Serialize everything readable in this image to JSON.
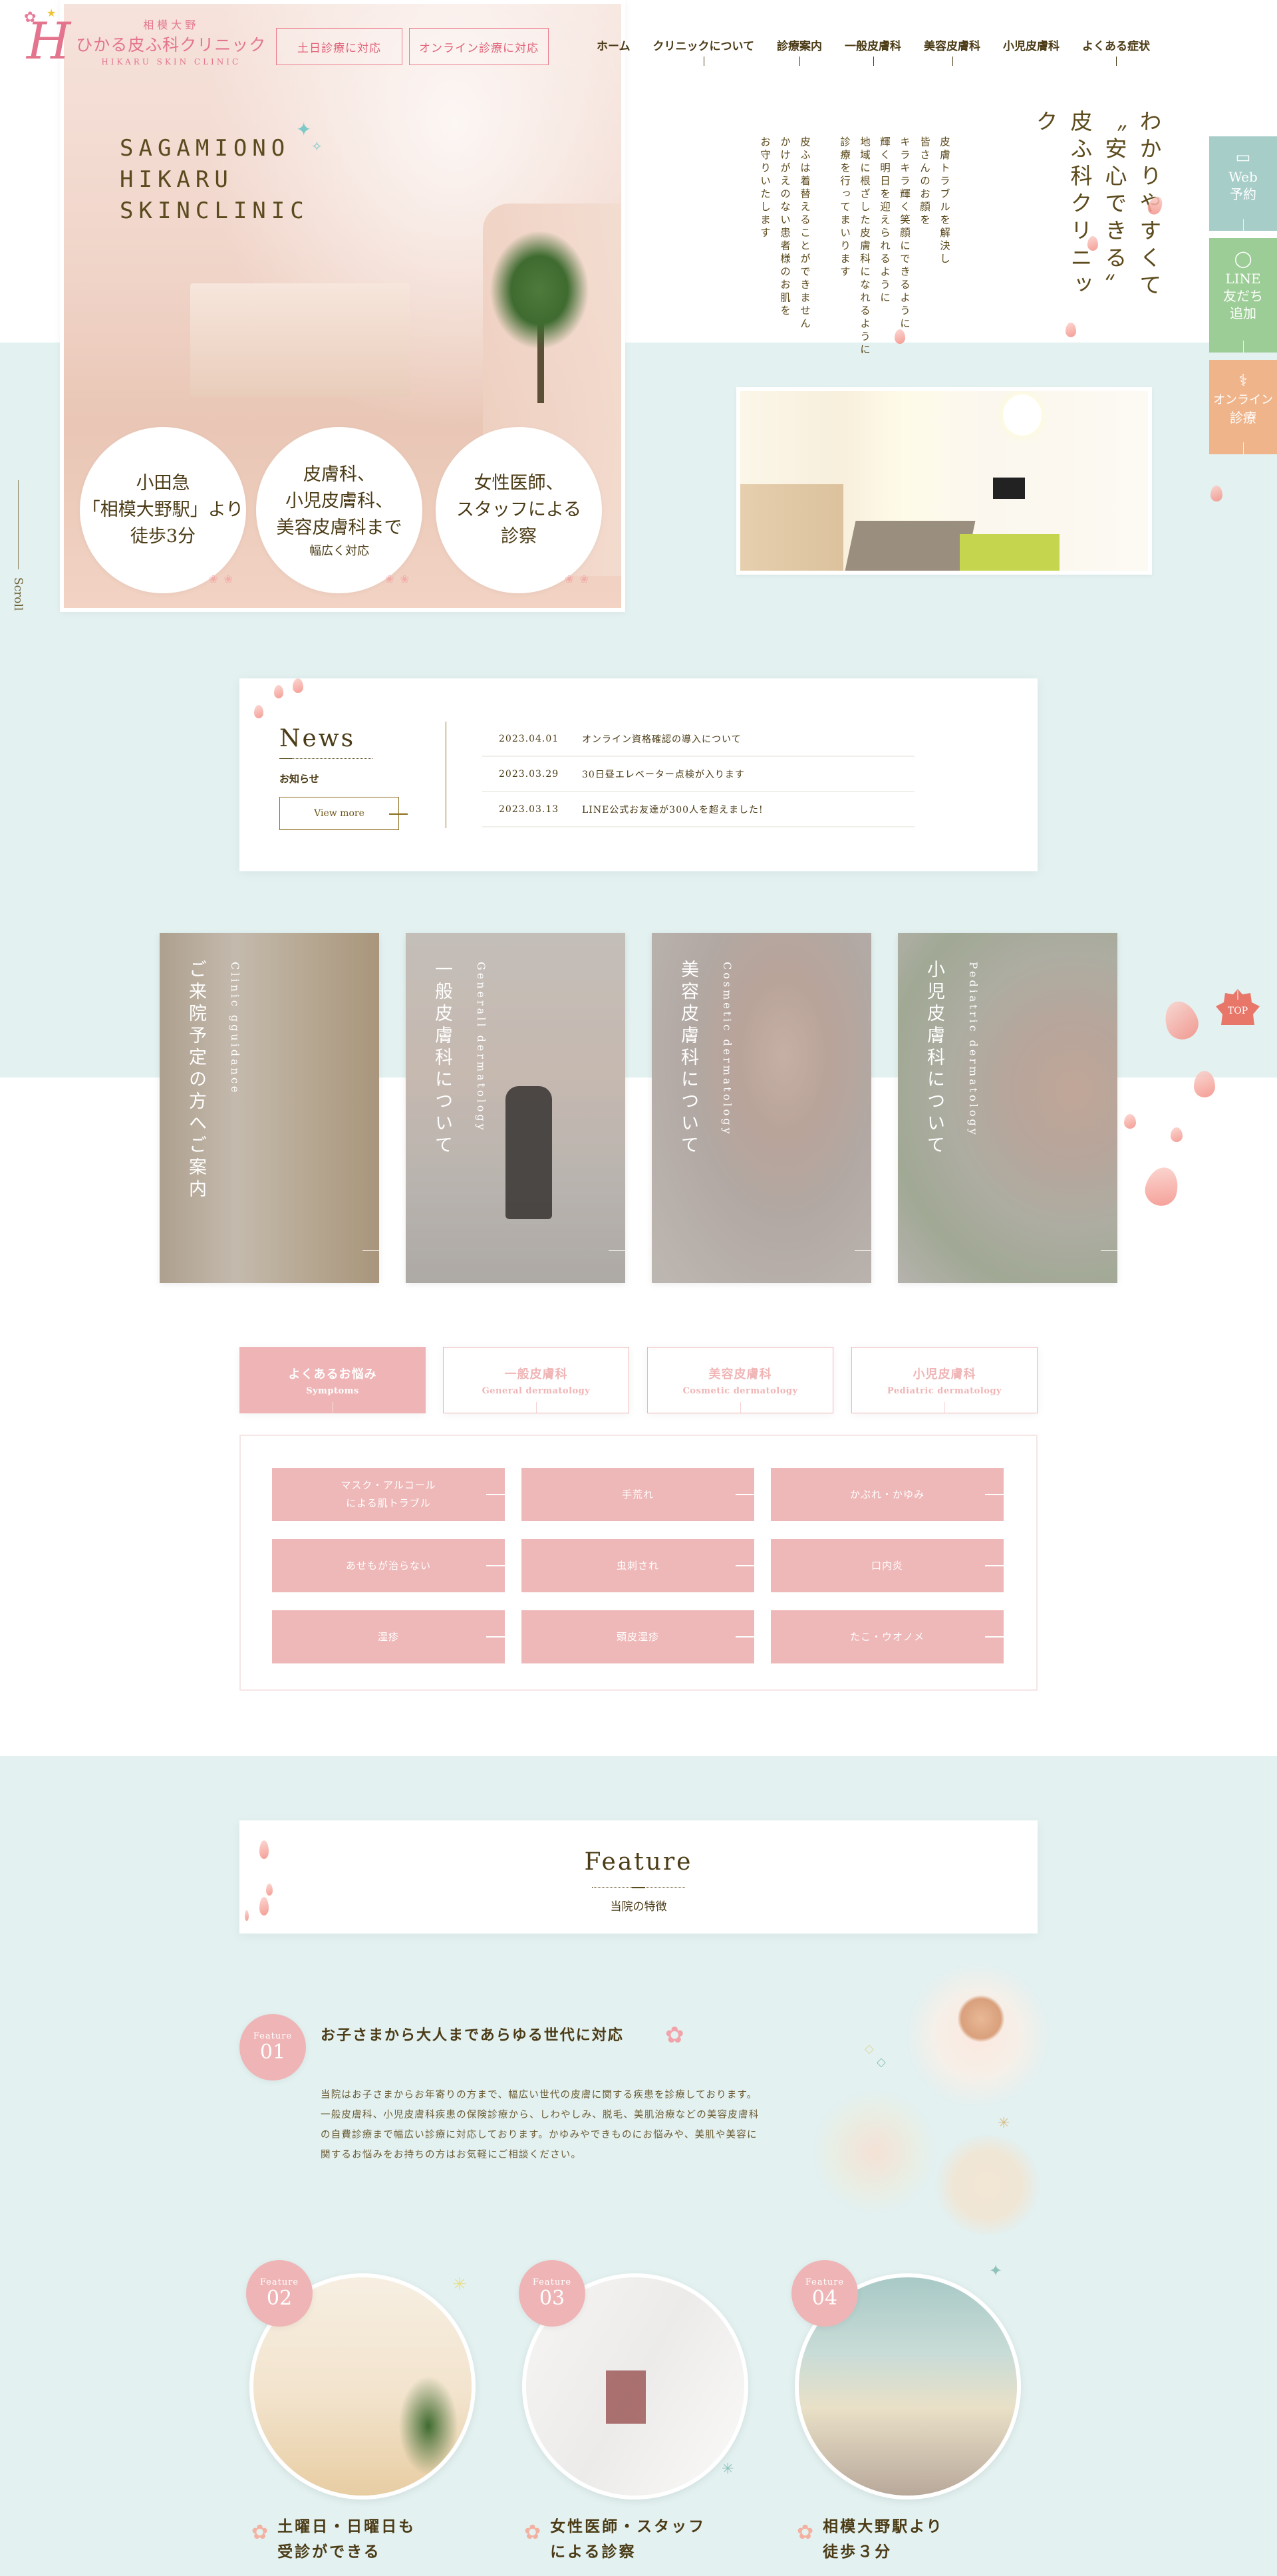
{
  "header": {
    "logo": {
      "line1": "相模大野",
      "line2": "ひかる皮ふ科クリニック",
      "line3": "HIKARU SKIN CLINIC",
      "mark": "H"
    },
    "badges": [
      "土日診療に対応",
      "オンライン診療に対応"
    ],
    "nav": [
      {
        "label": "ホーム",
        "has_submenu": false
      },
      {
        "label": "クリニックについて",
        "has_submenu": true
      },
      {
        "label": "診療案内",
        "has_submenu": true
      },
      {
        "label": "一般皮膚科",
        "has_submenu": true
      },
      {
        "label": "美容皮膚科",
        "has_submenu": true
      },
      {
        "label": "小児皮膚科",
        "has_submenu": false
      },
      {
        "label": "よくある症状",
        "has_submenu": true
      }
    ]
  },
  "hero": {
    "title_lines": [
      "SAGAMIONO",
      "HIKARU",
      "SKINCLINIC"
    ],
    "circles": [
      {
        "lines": [
          "小田急",
          "「相模大野駅」より",
          "徒歩3分"
        ]
      },
      {
        "lines": [
          "皮膚科、",
          "小児皮膚科、",
          "美容皮膚科まで",
          "幅広く対応"
        ]
      },
      {
        "lines": [
          "女性医師、",
          "スタッフによる",
          "診察"
        ]
      }
    ],
    "scroll_label": "Scroll"
  },
  "intro": {
    "heading": [
      "わかりやすくて",
      "〝安心できる〟",
      "皮ふ科クリニック"
    ],
    "body": [
      "皮膚トラブルを解決し",
      "皆さんのお顔を",
      "キラキラ輝く笑顔にできるように",
      "輝く明日を迎えられるように",
      "地域に根ざした皮膚科になれるように",
      "診療を行ってまいります",
      "",
      "皮ふは着替えることができません",
      "かけがえのない患者様のお肌を",
      "お守りいたします"
    ]
  },
  "side_buttons": [
    {
      "icon": "laptop-icon",
      "glyph": "💻",
      "lines": [
        "Web",
        "予約"
      ],
      "color": "#a7cdc9"
    },
    {
      "icon": "chat-bubble-icon",
      "glyph": "◯",
      "lines": [
        "LINE",
        "友だち",
        "追加"
      ],
      "color": "#9ccd96"
    },
    {
      "icon": "stethoscope-icon",
      "glyph": "⚕",
      "lines": [
        "オンライン",
        "診療"
      ],
      "color": "#f0b48a"
    }
  ],
  "top_button": {
    "label": "TOP",
    "color": "#e8776a"
  },
  "news": {
    "title": "News",
    "subtitle": "お知らせ",
    "more_label": "View more",
    "items": [
      {
        "date": "2023.04.01",
        "text": "オンライン資格確認の導入について"
      },
      {
        "date": "2023.03.29",
        "text": "30日昼エレベーター点検が入ります"
      },
      {
        "date": "2023.03.13",
        "text": "LINE公式お友達が300人を超えました!"
      }
    ]
  },
  "departments": [
    {
      "ja": "ご来院予定の方へご案内",
      "en": "Clinic gguidance"
    },
    {
      "ja": "一般皮膚科について",
      "en": "Generall dermatology"
    },
    {
      "ja": "美容皮膚科について",
      "en": "Cosmetic dermatology"
    },
    {
      "ja": "小児皮膚科について",
      "en": "Pediatric dermatology"
    }
  ],
  "symptoms": {
    "tabs": [
      {
        "ja": "よくあるお悩み",
        "en": "Symptoms",
        "active": true
      },
      {
        "ja": "一般皮膚科",
        "en": "General dermatology",
        "active": false
      },
      {
        "ja": "美容皮膚科",
        "en": "Cosmetic dermatology",
        "active": false
      },
      {
        "ja": "小児皮膚科",
        "en": "Pediatric dermatology",
        "active": false
      }
    ],
    "items": [
      "マスク・アルコール\nによる肌トラブル",
      "手荒れ",
      "かぶれ・かゆみ",
      "あせもが治らない",
      "虫刺され",
      "口内炎",
      "湿疹",
      "頭皮湿疹",
      "たこ・ウオノメ"
    ]
  },
  "feature": {
    "title": "Feature",
    "subtitle": "当院の特徴",
    "badge_label": "Feature",
    "items": [
      {
        "num": "01",
        "title": "お子さまから大人まであらゆる世代に対応",
        "body": "当院はお子さまからお年寄りの方まで、幅広い世代の皮膚に関する疾患を診療しております。一般皮膚科、小児皮膚科疾患の保険診療から、しわやしみ、脱毛、美肌治療などの美容皮膚科の自費診療まで幅広い診療に対応しております。かゆみやできものにお悩みや、美肌や美容に関するお悩みをお持ちの方はお気軽にご相談ください。"
      },
      {
        "num": "02",
        "title_lines": [
          "土曜日・日曜日も",
          "受診ができる"
        ]
      },
      {
        "num": "03",
        "title_lines": [
          "女性医師・スタッフ",
          "による診察"
        ]
      },
      {
        "num": "04",
        "title_lines": [
          "相模大野駅より",
          "徒歩３分"
        ]
      }
    ]
  },
  "colors": {
    "brand_pink": "#e4748e",
    "accent_pink": "#efb5b6",
    "mint_bg": "#e3f1f1",
    "text_brown": "#4b3b16"
  }
}
